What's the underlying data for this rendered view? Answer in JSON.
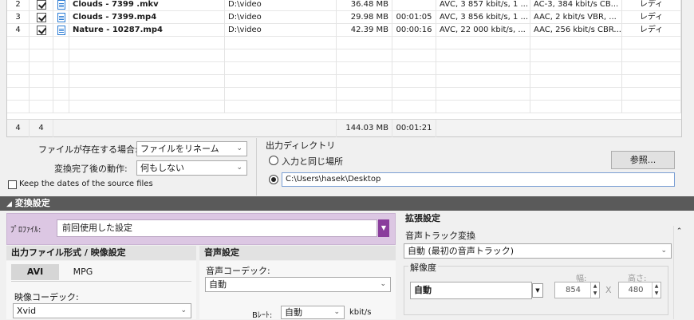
{
  "file_table": {
    "rows": [
      {
        "index": "2",
        "name": "Clouds - 7399 .mkv",
        "path": "D:\\video",
        "size": "36.48 MB",
        "duration": "",
        "video": "AVC, 3 857 kbit/s, 1 ...",
        "audio": "AC-3, 384 kbit/s CB...",
        "status": "レディ"
      },
      {
        "index": "3",
        "name": "Clouds - 7399.mp4",
        "path": "D:\\video",
        "size": "29.98 MB",
        "duration": "00:01:05",
        "video": "AVC, 3 856 kbit/s, 1 ...",
        "audio": "AAC, 2 kbit/s VBR, ...",
        "status": "レディ"
      },
      {
        "index": "4",
        "name": "Nature - 10287.mp4",
        "path": "D:\\video",
        "size": "42.39 MB",
        "duration": "00:00:16",
        "video": "AVC, 22 000 kbit/s, ...",
        "audio": "AAC, 256 kbit/s CBR...",
        "status": "レディ"
      }
    ],
    "totals": {
      "count": "4",
      "checked": "4",
      "size": "144.03 MB",
      "duration": "00:01:21"
    }
  },
  "options": {
    "if_exists_label": "ファイルが存在する場合:",
    "if_exists_value": "ファイルをリネーム",
    "after_done_label": "変換完了後の動作:",
    "after_done_value": "何もしない",
    "keep_dates_label": "Keep the dates of the source files",
    "output_dir_label": "出力ディレクトリ",
    "same_as_input_label": "入力と同じ場所",
    "output_path": "C:\\Users\\hasek\\Desktop",
    "browse_button": "参照..."
  },
  "conversion": {
    "section_title": "変換設定",
    "profile_label": "ﾌﾟﾛﾌｧｲﾙ:",
    "profile_value": "前回使用した設定",
    "output_format_title": "出力ファイル形式 / 映像設定",
    "tabs": [
      "AVI",
      "MPG"
    ],
    "video_codec_label": "映像コーデック:",
    "video_codec_value": "Xvid",
    "audio_title": "音声設定",
    "audio_codec_label": "音声コーデック:",
    "audio_codec_value": "自動",
    "bitrate_label": "Bﾚｰﾄ:",
    "bitrate_value": "自動",
    "bitrate_unit": "kbit/s"
  },
  "advanced": {
    "title": "拡張設定",
    "audio_track_label": "音声トラック変換",
    "audio_track_value": "自動 (最初の音声トラック)",
    "resolution_label": "解像度",
    "resolution_value": "自動",
    "width_label": "幅:",
    "height_label": "高さ:",
    "width_value": "854",
    "height_value": "480",
    "times": "X"
  },
  "colors": {
    "profile_bg": "#dcc7e3",
    "profile_accent": "#8a3d9c",
    "section_bar": "#5a5a5a"
  }
}
